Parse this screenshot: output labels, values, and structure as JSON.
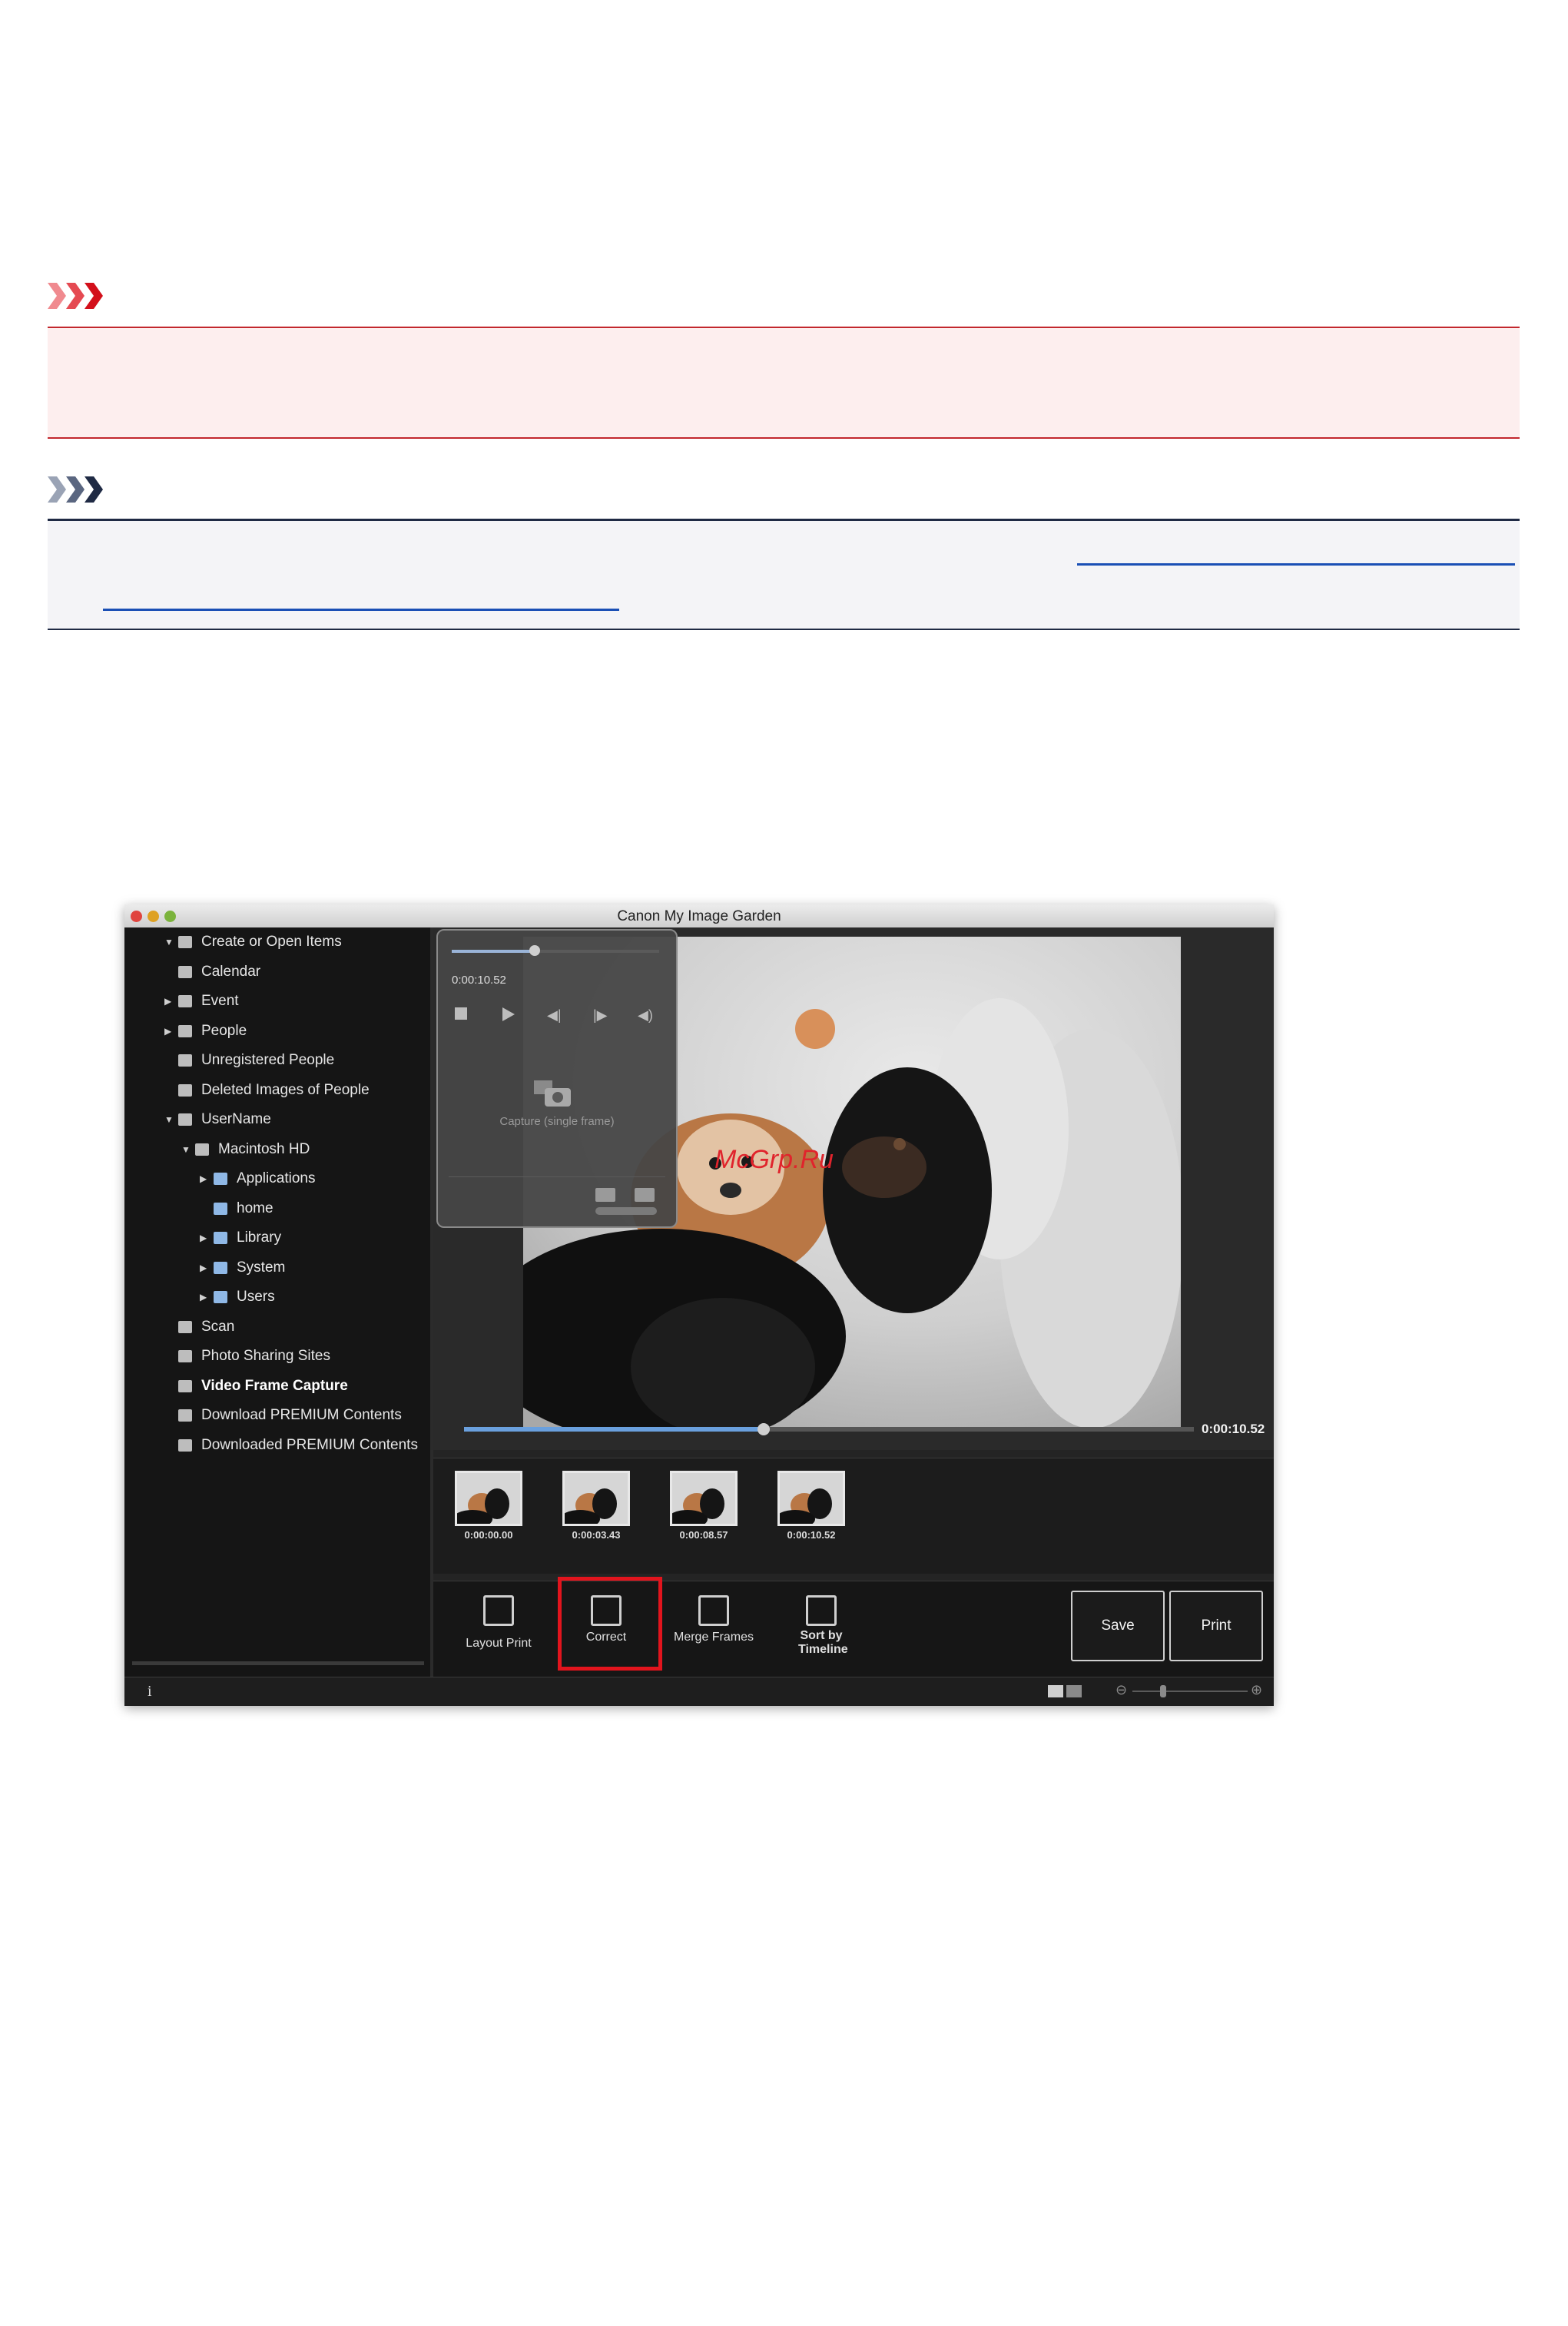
{
  "note": {
    "links": [
      "",
      ""
    ]
  },
  "app": {
    "title": "Canon My Image Garden",
    "sidebar": [
      {
        "label": "Create or Open Items",
        "level": 0,
        "arrow": "down"
      },
      {
        "label": "Calendar",
        "level": 0,
        "arrow": ""
      },
      {
        "label": "Event",
        "level": 0,
        "arrow": "right"
      },
      {
        "label": "People",
        "level": 0,
        "arrow": "right"
      },
      {
        "label": "Unregistered People",
        "level": 0,
        "arrow": ""
      },
      {
        "label": "Deleted Images of People",
        "level": 0,
        "arrow": ""
      },
      {
        "label": "UserName",
        "level": 0,
        "arrow": "down"
      },
      {
        "label": "Macintosh HD",
        "level": 1,
        "arrow": "down"
      },
      {
        "label": "Applications",
        "level": 2,
        "arrow": "right"
      },
      {
        "label": "home",
        "level": 2,
        "arrow": ""
      },
      {
        "label": "Library",
        "level": 2,
        "arrow": "right"
      },
      {
        "label": "System",
        "level": 2,
        "arrow": "right"
      },
      {
        "label": "Users",
        "level": 2,
        "arrow": "right"
      },
      {
        "label": "Scan",
        "level": 0,
        "arrow": ""
      },
      {
        "label": "Photo Sharing Sites",
        "level": 0,
        "arrow": ""
      },
      {
        "label": "Video Frame Capture",
        "level": 0,
        "arrow": "",
        "active": true
      },
      {
        "label": "Download PREMIUM Contents",
        "level": 0,
        "arrow": ""
      },
      {
        "label": "Downloaded PREMIUM Contents",
        "level": 0,
        "arrow": ""
      }
    ],
    "player": {
      "time": "0:00:10.52",
      "capture_label": "Capture (single frame)",
      "progress": 0.4
    },
    "timeline": {
      "time": "0:00:10.52",
      "progress": 0.41
    },
    "thumbnails": [
      "0:00:00.00",
      "0:00:03.43",
      "0:00:08.57",
      "0:00:10.52"
    ],
    "toolbar": {
      "layout_print": "Layout Print",
      "correct": "Correct",
      "merge_frames": "Merge Frames",
      "sort_by_timeline": "Sort by Timeline",
      "save": "Save",
      "print": "Print"
    },
    "watermark": "McGrp.Ru",
    "status_info": "i"
  }
}
